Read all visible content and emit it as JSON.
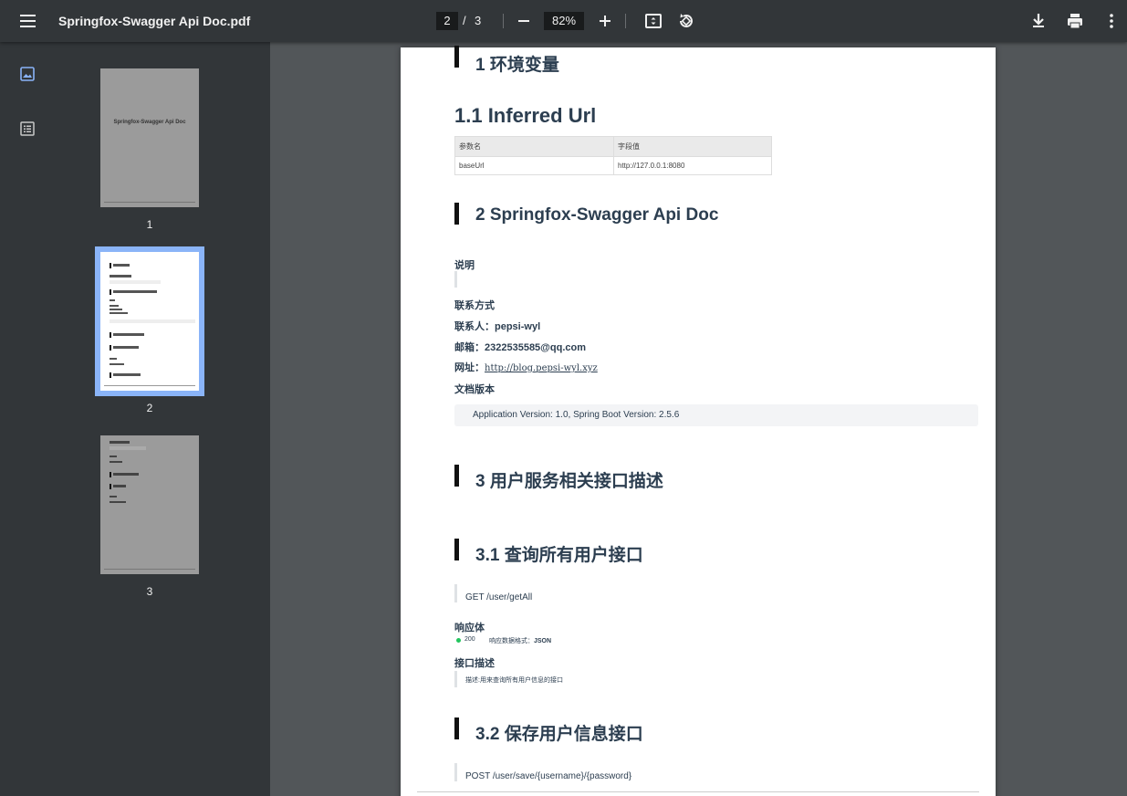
{
  "toolbar": {
    "title": "Springfox-Swagger Api Doc.pdf",
    "current_page": "2",
    "page_sep": "/",
    "total_pages": "3",
    "zoom": "82%"
  },
  "sidebar": {
    "thumbnails": [
      {
        "label": "1",
        "thumb_title": "Springfox-Swagger Api Doc"
      },
      {
        "label": "2"
      },
      {
        "label": "3"
      }
    ]
  },
  "document": {
    "sec1_title": "1 环境变量",
    "sec11_title": "1.1 Inferred Url",
    "table": {
      "headers": [
        "参数名",
        "字段值"
      ],
      "rows": [
        [
          "baseUrl",
          "http://127.0.0.1:8080"
        ]
      ]
    },
    "sec2_title": "2 Springfox-Swagger Api Doc",
    "desc_label": "说明",
    "contact_label": "联系方式",
    "contact_person_label": "联系人：",
    "contact_person": "pepsi-wyl",
    "email_label": "邮箱：",
    "email": "2322535585@qq.com",
    "website_label": "网址：",
    "website": "http://blog.pepsi-wyl.xyz",
    "version_label": "文档版本",
    "version_text": "Application Version: 1.0, Spring Boot Version: 2.5.6",
    "sec3_title": "3 用户服务相关接口描述",
    "sec31_title": "3.1 查询所有用户接口",
    "sec31_endpoint": "GET /user/getAll",
    "response_label": "响应体",
    "status_code": "200",
    "response_format_label": "响应数据格式：",
    "response_format": "JSON",
    "api_desc_label": "接口描述",
    "api_desc": "描述:用来查询所有用户信息的接口",
    "sec32_title": "3.2 保存用户信息接口",
    "sec32_endpoint": "POST /user/save/{username}/{password}"
  },
  "colors": {
    "toolbar_bg": "#323639",
    "viewer_bg": "#525659",
    "thumb_selected": "#8ab4f8",
    "status_ok": "#22c55e"
  }
}
